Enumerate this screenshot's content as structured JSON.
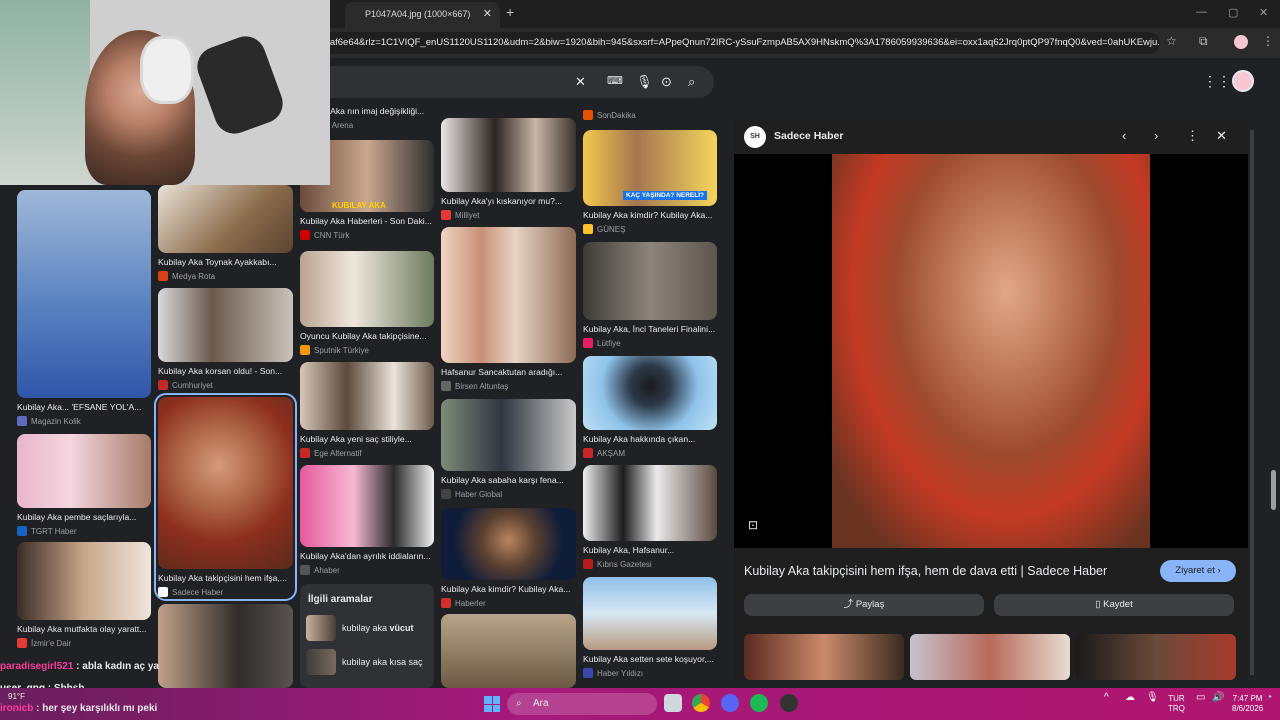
{
  "tab": {
    "title": "P1047A04.jpg (1000×667)",
    "close": "✕",
    "new": "+"
  },
  "address": {
    "url": "d0eaf6e64&rlz=1C1VIQF_enUS1120US1120&udm=2&biw=1920&bih=945&sxsrf=APpeQnun72IRC-ySsuFzmpAB5AX9HNskmQ%3A1786059939636&ei=oxx1aq62Jrq0ptQP97fnqQ0&ved=0ahUKEwju..."
  },
  "colors": {
    "accent": "#8ab4f8",
    "bg": "#202124",
    "taskbar": "#a4197a"
  },
  "grid": [
    {
      "caption": "Kubilay Aka nın imaj değişikliği...",
      "source": "Fete Arena",
      "fav": "#888888"
    },
    {
      "caption": "Kubilay Aka Haberleri - Son Daki...",
      "source": "CNN Türk",
      "fav": "#cc0000",
      "overlay": "KUBILAY AKA"
    },
    {
      "caption": "Oyuncu Kubilay Aka takipçisine...",
      "source": "Sputnik Türkiye",
      "fav": "#f29900"
    },
    {
      "caption": "Kubilay Aka yeni saç stiliyle...",
      "source": "Ege Alternatif",
      "fav": "#c62828"
    },
    {
      "caption": "Kubilay Aka'dan ayrılık iddiaların...",
      "source": "Ahaber",
      "fav": "#555555"
    },
    {
      "caption": "Kubilay Aka'yı kıskanıyor mu?...",
      "source": "Milliyet",
      "fav": "#e53935"
    },
    {
      "caption": "Hafsanur Sancaktutan aradığı...",
      "source": "Birsen Altuntaş",
      "fav": "#666666"
    },
    {
      "caption": "Kubilay Aka sabaha karşı fena...",
      "source": "Haber Global",
      "fav": "#444444"
    },
    {
      "caption": "Kubilay Aka kimdir? Kubilay Aka...",
      "source": "Haberler",
      "fav": "#d32f2f"
    },
    {
      "caption": "Kubilay Aka kimdir? Kubilay Aka...",
      "source": "GÜNEŞ",
      "fav": "#fbc02d",
      "overlay": "KAÇ YAŞINDA? NERELİ?"
    },
    {
      "caption": "Kubilay Aka, İnci Taneleri Finalini...",
      "source": "Lütfiye",
      "fav": "#e91e63"
    },
    {
      "caption": "Kubilay Aka hakkında çıkan...",
      "source": "AKŞAM",
      "fav": "#c62828"
    },
    {
      "caption": "Kubilay Aka, Hafsanur...",
      "source": "Kıbrıs Gazetesi",
      "fav": "#b71c1c"
    },
    {
      "caption": "Kubilay Aka setten sete koşuyor,...",
      "source": "Haber Yıldızı",
      "fav": "#3949ab"
    },
    {
      "caption": "Kubilay Aka... 'EFSANE YOL'A...",
      "source": "Magazin Kolik",
      "fav": "#5c6bc0"
    },
    {
      "caption": "Kubilay Aka Toynak Ayakkabı...",
      "source": "Medya Rota",
      "fav": "#d84315"
    },
    {
      "caption": "Kubilay Aka korsan oldu! - Son...",
      "source": "Cumhuriyet",
      "fav": "#c62828"
    },
    {
      "caption": "Kubilay Aka takipçisini hem ifşa,...",
      "source": "Sadece Haber",
      "fav": "#ffffff"
    },
    {
      "caption": "Kubilay Aka pembe saçlarıyla...",
      "source": "TGRT Haber",
      "fav": "#1565c0"
    },
    {
      "caption": "Kubilay Aka mutfakta olay yaratt...",
      "source": "İzmir'e Dair",
      "fav": "#e53935"
    },
    {
      "caption": "SonDakika",
      "source": "SonDakika",
      "fav": "#e65100"
    }
  ],
  "related": {
    "title": "İlgili aramalar",
    "items": [
      {
        "pre": "kubilay aka ",
        "bold": "vücut"
      },
      {
        "pre": "kubilay aka kısa saç",
        "bold": ""
      }
    ]
  },
  "preview": {
    "source_name": "Sadece Haber",
    "logo_text": "SH",
    "title": "Kubilay Aka takipçisini hem ifşa, hem de dava etti | Sadece Haber",
    "visit_label": "Ziyaret et",
    "share_label": "Paylaş",
    "save_label": "Kaydet"
  },
  "chat": [
    {
      "user": "paradisegirl521",
      "sep": " : ",
      "text": "abla kadın aç ya",
      "color": "#ff3aa0"
    },
    {
      "user": "user_qpq",
      "sep": " : ",
      "text": "Shhsh",
      "color": "#ffffff"
    },
    {
      "user": "ironicb",
      "sep": " : ",
      "text": "her şey karşılıklı mı peki",
      "color": "#ff3aa0"
    }
  ],
  "taskbar": {
    "search_placeholder": "Ara",
    "weather": "91°F",
    "lang_top": "TUR",
    "lang_bottom": "TRQ",
    "time": "7:47 PM",
    "date": "8/6/2026"
  }
}
